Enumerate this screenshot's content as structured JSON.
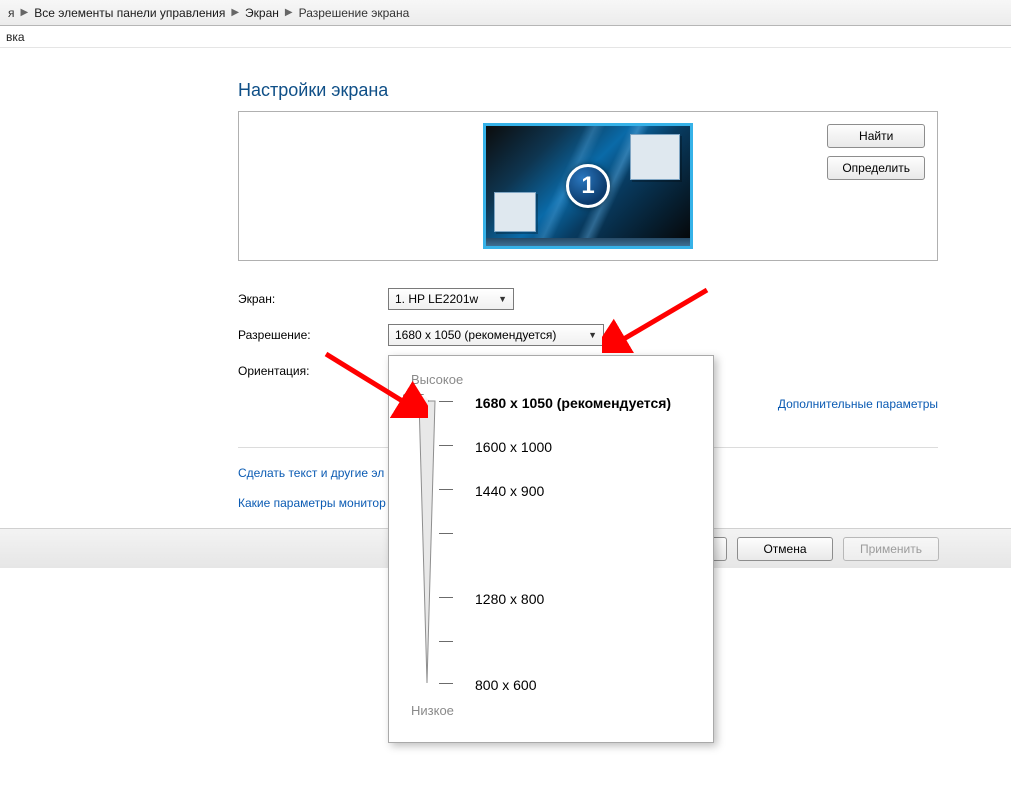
{
  "breadcrumbs": {
    "prefix": "я",
    "item1": "Все элементы панели управления",
    "item2": "Экран",
    "item3": "Разрешение экрана"
  },
  "menu": {
    "item": "вка"
  },
  "page": {
    "title": "Настройки экрана"
  },
  "buttons": {
    "find": "Найти",
    "identify": "Определить",
    "cancel": "Отмена",
    "apply": "Применить"
  },
  "monitor": {
    "badge": "1"
  },
  "labels": {
    "screen": "Экран:",
    "resolution": "Разрешение:",
    "orientation": "Ориентация:"
  },
  "dropdowns": {
    "screen_value": "1. HP LE2201w",
    "resolution_value": "1680 x 1050 (рекомендуется)"
  },
  "links": {
    "advanced": "Дополнительные параметры",
    "text_size": "Сделать текст и другие эл",
    "monitor_params": "Какие параметры монитор"
  },
  "res_popup": {
    "high": "Высокое",
    "low": "Низкое",
    "options": {
      "r0": "1680 x 1050 (рекомендуется)",
      "r1": "1600 x 1000",
      "r2": "1440 x 900",
      "r3": "1280 x 800",
      "r4": "800 x 600"
    }
  }
}
